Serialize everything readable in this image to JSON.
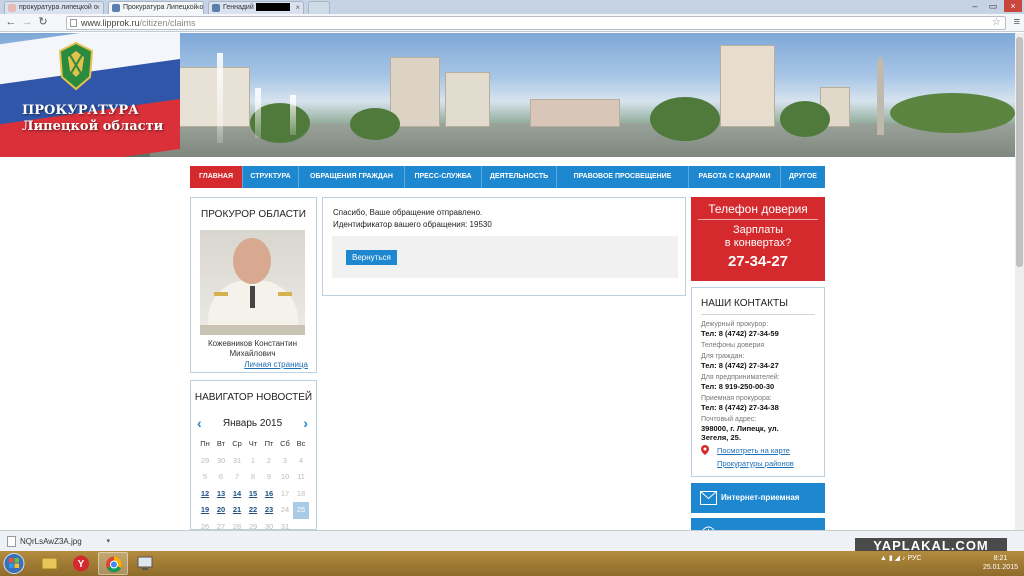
{
  "browser": {
    "tabs": [
      {
        "title": "прокуратура липецкой о",
        "active": false
      },
      {
        "title": "Прокуратура Липецкой о",
        "active": true
      },
      {
        "title": "Геннадий",
        "active": false
      }
    ],
    "url_host": "www.lipprok.ru",
    "url_path": "/citizen/claims"
  },
  "banner": {
    "title_line1": "ПРОКУРАТУРА",
    "title_line2": "Липецкой области"
  },
  "nav": [
    {
      "label": "Главная",
      "active": true
    },
    {
      "label": "Структура",
      "active": false
    },
    {
      "label": "Обращения граждан",
      "active": false
    },
    {
      "label": "Пресс-служба",
      "active": false
    },
    {
      "label": "Деятельность",
      "active": false
    },
    {
      "label": "Правовое просвещение",
      "active": false
    },
    {
      "label": "Работа с кадрами",
      "active": false
    },
    {
      "label": "Другое",
      "active": false
    }
  ],
  "prosecutor": {
    "title": "Прокурор области",
    "name": "Кожевников Константин Михайлович",
    "personal_link": "Личная страница"
  },
  "news_nav": {
    "title": "Навигатор новостей",
    "month": "Январь 2015",
    "weekdays": [
      "Пн",
      "Вт",
      "Ср",
      "Чт",
      "Пт",
      "Сб",
      "Вс"
    ],
    "weeks": [
      [
        {
          "d": "29",
          "k": "off"
        },
        {
          "d": "30",
          "k": "off"
        },
        {
          "d": "31",
          "k": "off"
        },
        {
          "d": "1",
          "k": "off"
        },
        {
          "d": "2",
          "k": "off"
        },
        {
          "d": "3",
          "k": "off"
        },
        {
          "d": "4",
          "k": "off"
        }
      ],
      [
        {
          "d": "5",
          "k": "off"
        },
        {
          "d": "6",
          "k": "off"
        },
        {
          "d": "7",
          "k": "off"
        },
        {
          "d": "8",
          "k": "off"
        },
        {
          "d": "9",
          "k": "off"
        },
        {
          "d": "10",
          "k": "off"
        },
        {
          "d": "11",
          "k": "off"
        }
      ],
      [
        {
          "d": "12",
          "k": "link"
        },
        {
          "d": "13",
          "k": "link"
        },
        {
          "d": "14",
          "k": "link"
        },
        {
          "d": "15",
          "k": "link"
        },
        {
          "d": "16",
          "k": "link"
        },
        {
          "d": "17",
          "k": "off"
        },
        {
          "d": "18",
          "k": "off"
        }
      ],
      [
        {
          "d": "19",
          "k": "link"
        },
        {
          "d": "20",
          "k": "link"
        },
        {
          "d": "21",
          "k": "link"
        },
        {
          "d": "22",
          "k": "link"
        },
        {
          "d": "23",
          "k": "link"
        },
        {
          "d": "24",
          "k": "off"
        },
        {
          "d": "25",
          "k": "today"
        }
      ],
      [
        {
          "d": "26",
          "k": "off"
        },
        {
          "d": "27",
          "k": "off"
        },
        {
          "d": "28",
          "k": "off"
        },
        {
          "d": "29",
          "k": "off"
        },
        {
          "d": "30",
          "k": "off"
        },
        {
          "d": "31",
          "k": "off"
        },
        {
          "d": "",
          "k": "off"
        }
      ]
    ]
  },
  "main": {
    "line1": "Спасибо, Ваше обращение отправлено.",
    "line2": "Идентификатор вашего обращения: 19530",
    "back_button": "Вернуться"
  },
  "hotline": {
    "title": "Телефон доверия",
    "line1": "Зарплаты",
    "line2": "в конвертах?",
    "phone": "27-34-27"
  },
  "contacts": {
    "title": "Наши контакты",
    "rows": [
      {
        "label": "Дежурный прокурор:",
        "value": "Тел: 8 (4742) 27-34-59"
      },
      {
        "label": "Телефоны доверия",
        "value": ""
      },
      {
        "label": "Для граждан:",
        "value": "Тел: 8 (4742) 27-34-27"
      },
      {
        "label": "Для предпринимателей:",
        "value": "Тел: 8 919-250-00-30"
      },
      {
        "label": "Приемная прокурора:",
        "value": "Тел: 8 (4742) 27-34-38"
      },
      {
        "label": "Почтовый адрес:",
        "value": "398000, г. Липецк, ул. Зегеля, 25."
      }
    ],
    "map_link": "Посмотреть на карте",
    "district_link": "Прокуратуры районов"
  },
  "right_boxes": {
    "internet": "Интернет-приемная"
  },
  "downloads": {
    "file": "NQrLsAwZ3A.jpg",
    "watermark": "YAPLAKAL.COM"
  },
  "taskbar": {
    "lang": "РУС",
    "time": "8:21",
    "date": "25.01.2015"
  },
  "colors": {
    "accent_blue": "#1d87d0",
    "accent_red": "#d42a2e"
  }
}
